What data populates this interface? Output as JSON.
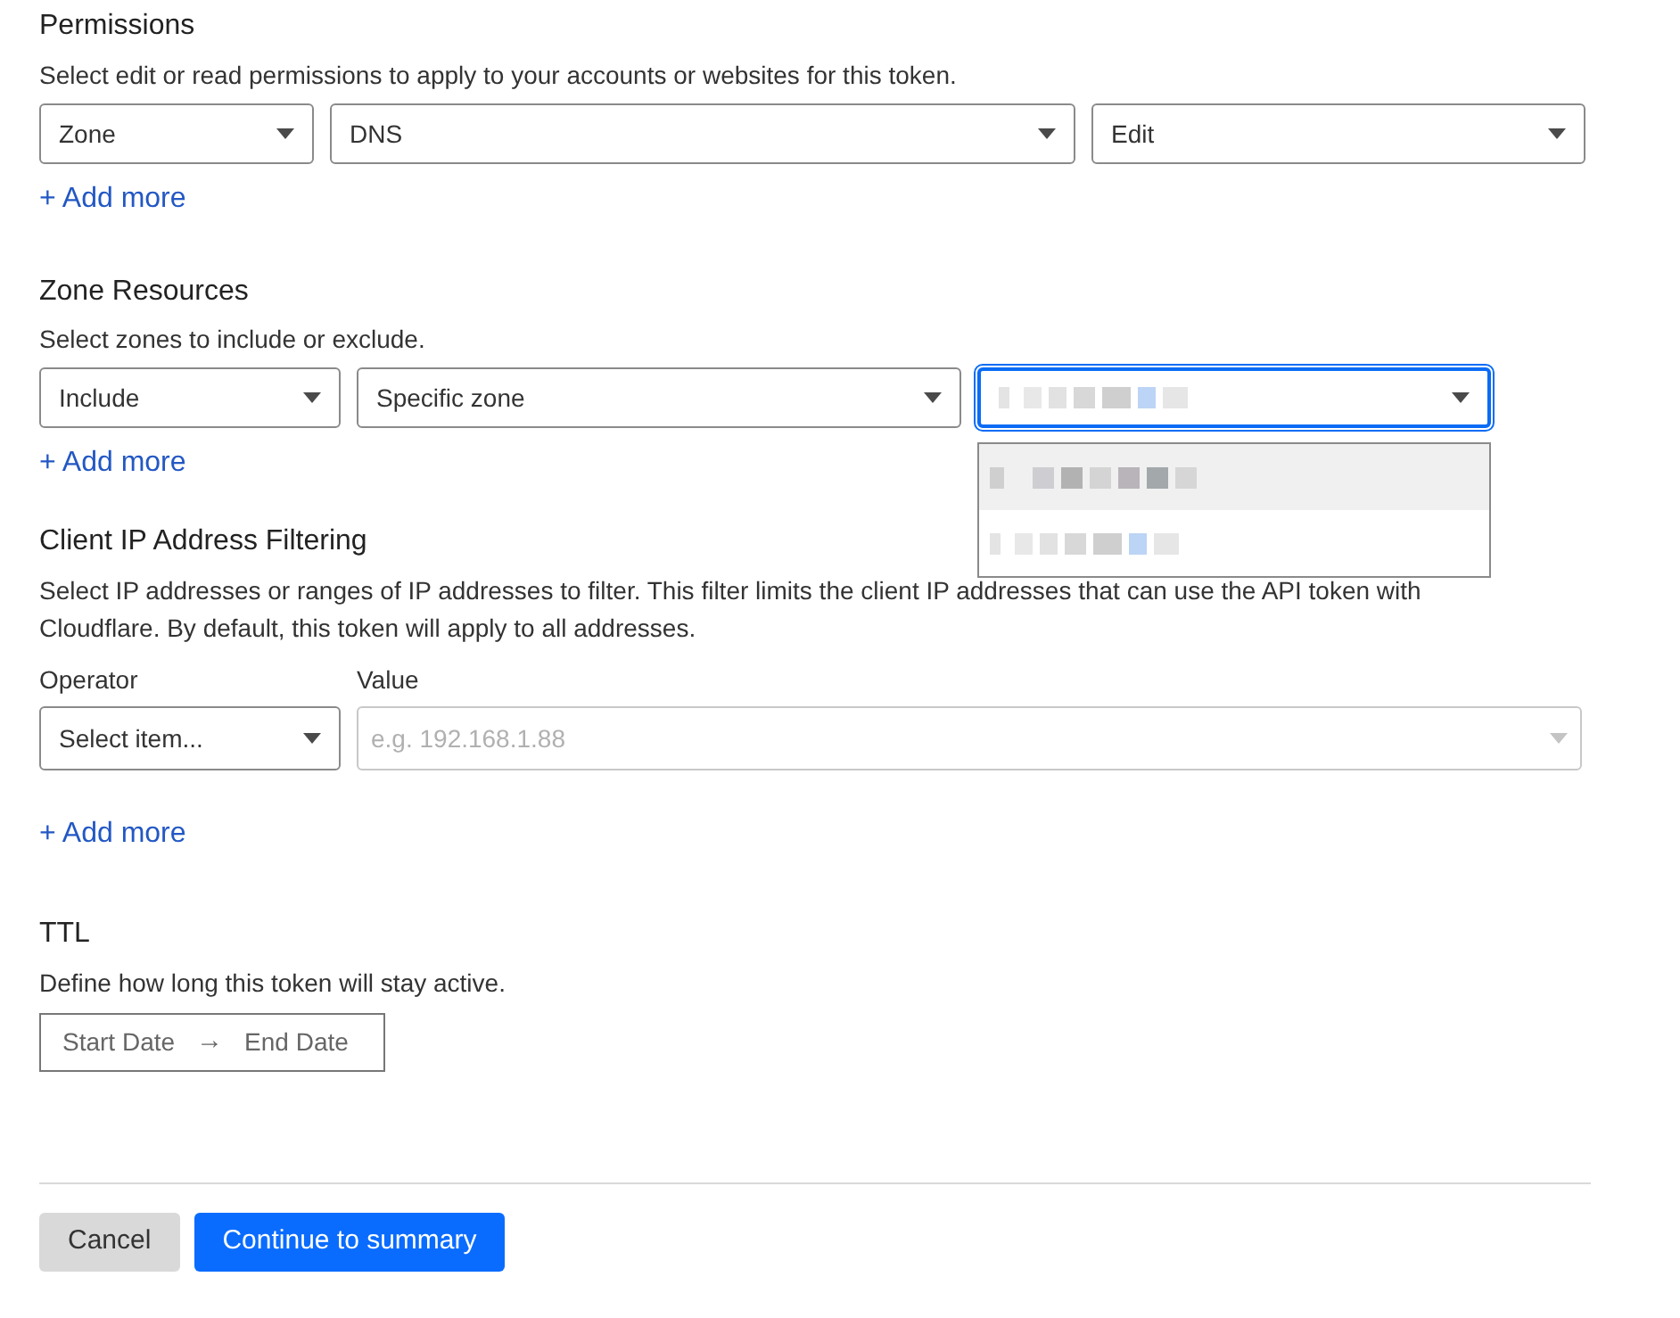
{
  "permissions": {
    "title": "Permissions",
    "description": "Select edit or read permissions to apply to your accounts or websites for this token.",
    "selects": [
      {
        "kind": "text",
        "value": "Zone"
      },
      {
        "kind": "text",
        "value": "DNS"
      },
      {
        "kind": "text",
        "value": "Edit"
      }
    ],
    "add_more": "+ Add more"
  },
  "zone_resources": {
    "title": "Zone Resources",
    "description": "Select zones to include or exclude.",
    "selects": [
      {
        "kind": "text",
        "value": "Include",
        "focused": false
      },
      {
        "kind": "text",
        "value": "Specific zone",
        "focused": false
      },
      {
        "kind": "redacted",
        "focused": true
      }
    ],
    "dropdown": {
      "expanded": true,
      "options": [
        {
          "highlighted": true
        },
        {
          "highlighted": false
        }
      ]
    },
    "add_more": "+ Add more"
  },
  "ip_filtering": {
    "title": "Client IP Address Filtering",
    "description": "Select IP addresses or ranges of IP addresses to filter. This filter limits the client IP addresses that can use the API token with Cloudflare. By default, this token will apply to all addresses.",
    "operator": {
      "label": "Operator",
      "value": "Select item..."
    },
    "value_field": {
      "label": "Value",
      "placeholder": "e.g. 192.168.1.88",
      "disabled": true
    },
    "add_more": "+ Add more"
  },
  "ttl": {
    "title": "TTL",
    "description": "Define how long this token will stay active.",
    "start": "Start Date",
    "arrow": "→",
    "end": "End Date"
  },
  "buttons": [
    {
      "kind": "secondary",
      "label": "Cancel"
    },
    {
      "kind": "primary",
      "label": "Continue to summary"
    }
  ]
}
